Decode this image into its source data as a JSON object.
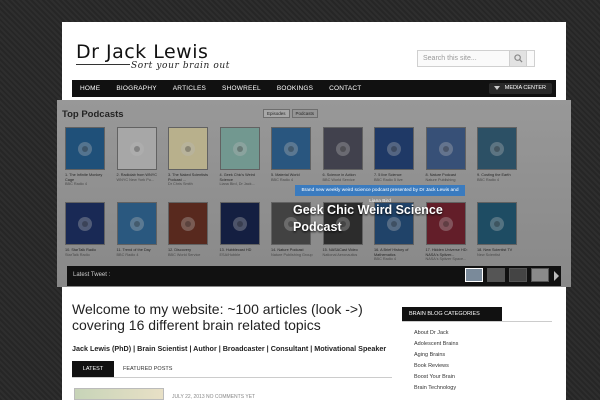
{
  "header": {
    "title": "Dr Jack Lewis",
    "tagline": "Sort your brain out",
    "search_placeholder": "Search this site..."
  },
  "nav": {
    "items": [
      "HOME",
      "BIOGRAPHY",
      "ARTICLES",
      "SHOWREEL",
      "BOOKINGS",
      "CONTACT"
    ],
    "media_center": "MEDIA CENTER"
  },
  "slider": {
    "title": "Top Podcasts",
    "tabs": [
      "Episodes",
      "Podcasts"
    ],
    "active_tab": "Podcasts",
    "row1": [
      {
        "caption": "1. The Infinite Monkey Cage",
        "sub": "BBC Radio 4",
        "color": "#2c6fa8",
        "icon": "bbc-radio4-icon"
      },
      {
        "caption": "2. Radiolab from WNYC",
        "sub": "WNYC New York Pu...",
        "color": "#e8e8e8",
        "icon": "radiolab-icon"
      },
      {
        "caption": "3. The Naked Scientists Podcast ...",
        "sub": "Dr Chris Smith",
        "color": "#fff4c2",
        "icon": "naked-scientists-icon"
      },
      {
        "caption": "4. Geek Chic's Weird Science",
        "sub": "Liana Bird, Dr Jack...",
        "color": "#9ed3c8",
        "icon": "geek-chic-icon"
      },
      {
        "caption": "5. Material World",
        "sub": "BBC Radio 4",
        "color": "#3a78b0",
        "icon": "bbc-radio4-icon"
      },
      {
        "caption": "6. Science in Action",
        "sub": "BBC World Service",
        "color": "#5b5b6b",
        "icon": "science-in-action-icon"
      },
      {
        "caption": "7. 5 live Science",
        "sub": "BBC Radio 5 live",
        "color": "#2b4f8e",
        "icon": "bbc-5live-icon"
      },
      {
        "caption": "8. Nature Podcast",
        "sub": "Nature Publishing",
        "color": "#4d6fa6",
        "icon": "bbc-radio4-icon"
      },
      {
        "caption": "9. Costing the Earth",
        "sub": "BBC Radio 4",
        "color": "#3d6f8d",
        "icon": "bbc-radio4-icon"
      }
    ],
    "row2": [
      {
        "caption": "10. StarTalk Radio",
        "sub": "StarTalk Radio",
        "color": "#233a76",
        "icon": "startalk-icon"
      },
      {
        "caption": "11. Trend of the Day",
        "sub": "BBC Radio 4",
        "color": "#3b7ab0",
        "icon": "bbc-radio4-icon"
      },
      {
        "caption": "12. Discovery",
        "sub": "BBC World Service",
        "color": "#7a3a2a",
        "icon": "discovery-icon"
      },
      {
        "caption": "13. Hubblecast HD",
        "sub": "ESA/Hubble",
        "color": "#1d2b5a",
        "icon": "hubblecast-icon"
      },
      {
        "caption": "14. Nature Podcast",
        "sub": "Nature Publishing Group",
        "color": "#5c5c5c",
        "icon": "nature-icon"
      },
      {
        "caption": "15. NASACast Video",
        "sub": "National Aeronautics",
        "color": "#3e3e3e",
        "icon": "nasacast-icon"
      },
      {
        "caption": "16. A Brief History of Mathematics",
        "sub": "BBC Radio 4",
        "color": "#2d5d92",
        "icon": "bbc-radio4-icon"
      },
      {
        "caption": "17. Hidden Universe HD: NASA's Spitzer...",
        "sub": "NASA's Spitzer Space...",
        "color": "#8a2a3a",
        "icon": "hidden-universe-icon"
      },
      {
        "caption": "18. New Scientist TV",
        "sub": "New Scientist",
        "color": "#2a6a8a",
        "icon": "new-scientist-icon"
      }
    ],
    "promo_bar": "Brand new weekly weird science podcast presented by Dr Jack Lewis and Liana Bird",
    "promo_title": "Geek Chic Weird Science Podcast",
    "tweet_label": "Latest Tweet :"
  },
  "main": {
    "welcome": "Welcome to my website: ~100 articles (look ->) covering 16 different brain related topics",
    "credits": "Jack Lewis (PhD) | Brain Scientist | Author | Broadcaster | Consultant | Motivational Speaker",
    "tab_latest": "LATEST",
    "tab_featured": "FEATURED POSTS",
    "post_meta": "JULY 22, 2013  NO COMMENTS YET"
  },
  "sidebar": {
    "heading": "BRAIN BLOG CATEGORIES",
    "categories": [
      "About Dr Jack",
      "Adolescent Brains",
      "Aging Brains",
      "Book Reviews",
      "Boost Your Brain",
      "Brain Technology"
    ]
  }
}
